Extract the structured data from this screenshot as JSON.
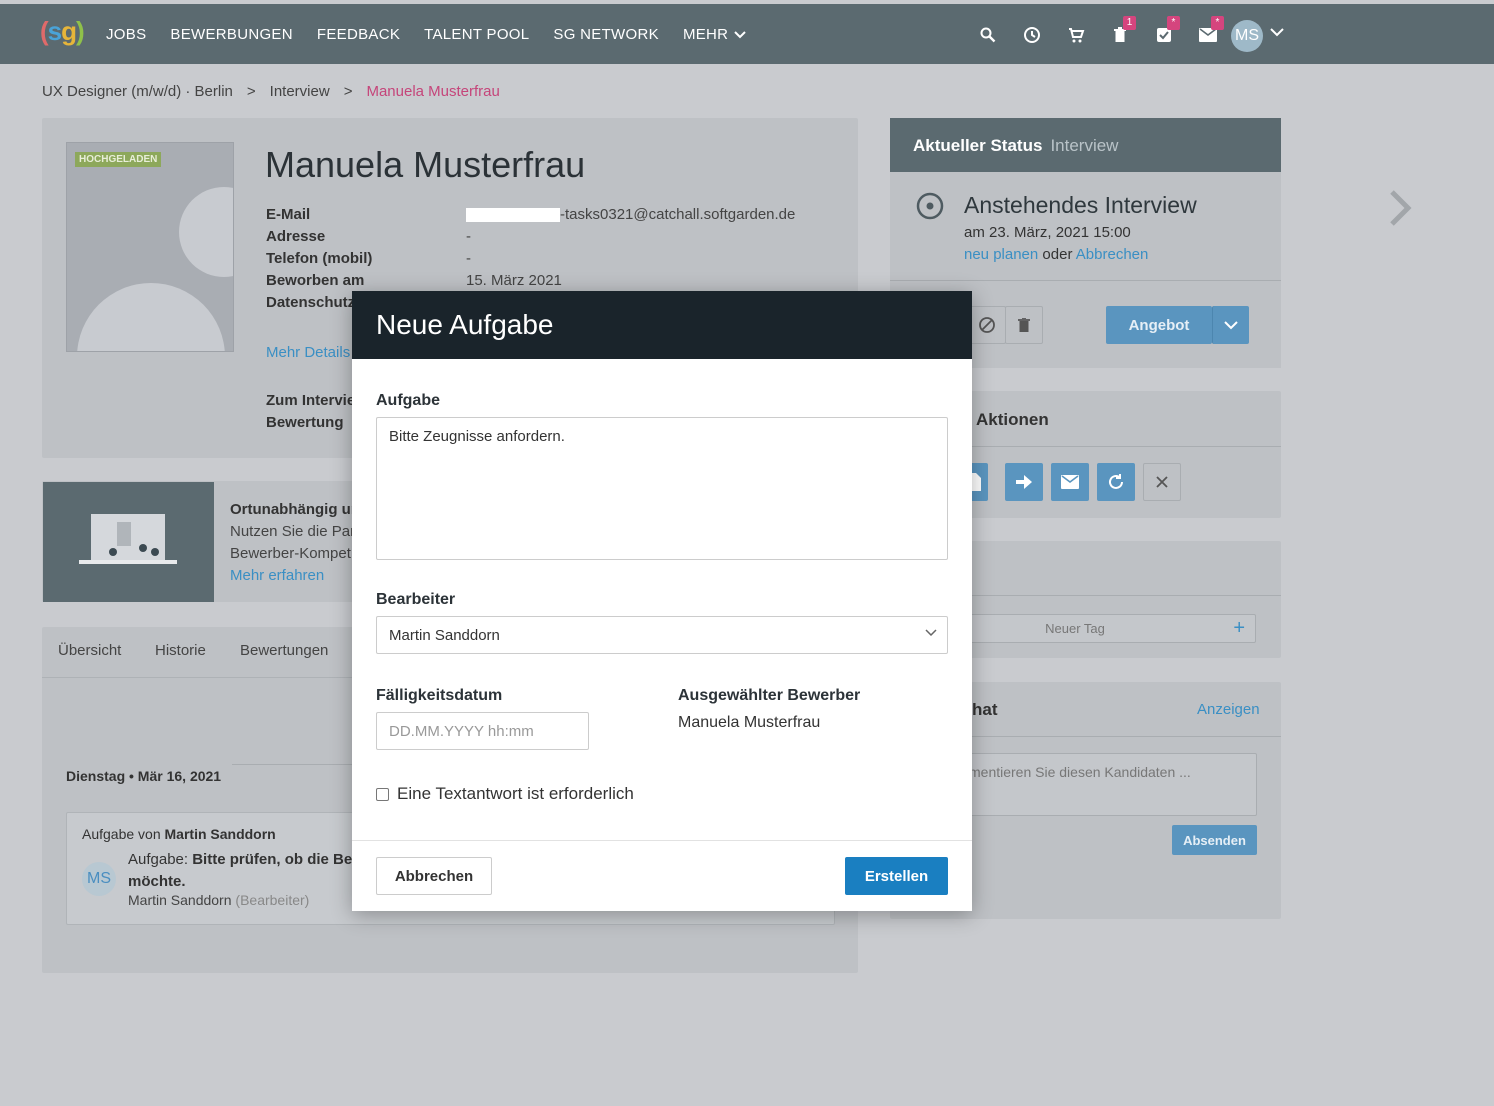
{
  "nav": {
    "logo_p1": "(",
    "logo_s": "s",
    "logo_g": "g",
    "logo_p2": ")",
    "items": [
      "JOBS",
      "BEWERBUNGEN",
      "FEEDBACK",
      "TALENT POOL",
      "SG NETWORK",
      "MEHR"
    ]
  },
  "badges": {
    "trash": "1",
    "tasks": "*",
    "mail": "*"
  },
  "user": {
    "initials": "MS"
  },
  "breadcrumb": [
    "UX Designer (m/w/d) · Berlin",
    ">",
    "Interview",
    ">",
    "Manuela Musterfrau"
  ],
  "profile": {
    "tag": "HOCHGELADEN",
    "name": "Manuela Musterfrau",
    "labels": [
      "E-Mail",
      "Adresse",
      "Telefon (mobil)",
      "Beworben am",
      "Datenschutz"
    ],
    "email_suffix": "-tasks0321@catchall.softgarden.de",
    "address": "-",
    "phone": "-",
    "applied": "15. März 2021",
    "more": "Mehr Details",
    "interview_label": "Zum Intervie",
    "rating_label": "Bewertung"
  },
  "promo": {
    "title": "Ortunabhängig ur",
    "line1": "Nutzen Sie die Part",
    "line2": "Bewerber-Kompet",
    "link": "Mehr erfahren"
  },
  "tabs": [
    "Übersicht",
    "Historie",
    "Bewertungen"
  ],
  "timeline": {
    "date": "Dienstag • Mär 16, 2021",
    "from_prefix": "Aufgabe von ",
    "from_name": "Martin Sanddorn",
    "task_prefix": "Aufgabe: ",
    "task_bold1": "Bitte prüfen, ob die Bev",
    "task_bold2": "möchte.",
    "assignee": "Martin Sanddorn",
    "assignee_role": "(Bearbeiter)",
    "avatar": "MS"
  },
  "status": {
    "title": "Aktueller Status",
    "value": "Interview",
    "event": "Anstehendes Interview",
    "when": "am 23. März, 2021 15:00",
    "replan": "neu planen",
    "or": "oder",
    "cancel": "Abbrechen",
    "offer": "Angebot"
  },
  "actions": {
    "title": "Aktionen"
  },
  "tags": {
    "placeholder": "Neuer Tag",
    "add": "+"
  },
  "chat": {
    "title": "hat",
    "show": "Anzeigen",
    "placeholder": "mentieren Sie diesen Kandidaten ...",
    "send": "Absenden"
  },
  "modal": {
    "title": "Neue Aufgabe",
    "task_label": "Aufgabe",
    "task_value": "Bitte Zeugnisse anfordern.",
    "assignee_label": "Bearbeiter",
    "assignee_value": "Martin Sanddorn",
    "due_label": "Fälligkeitsdatum",
    "due_placeholder": "DD.MM.YYYY hh:mm",
    "selected_label": "Ausgewählter Bewerber",
    "selected_value": "Manuela Musterfrau",
    "text_required": "Eine Textantwort ist erforderlich",
    "cancel": "Abbrechen",
    "create": "Erstellen"
  }
}
